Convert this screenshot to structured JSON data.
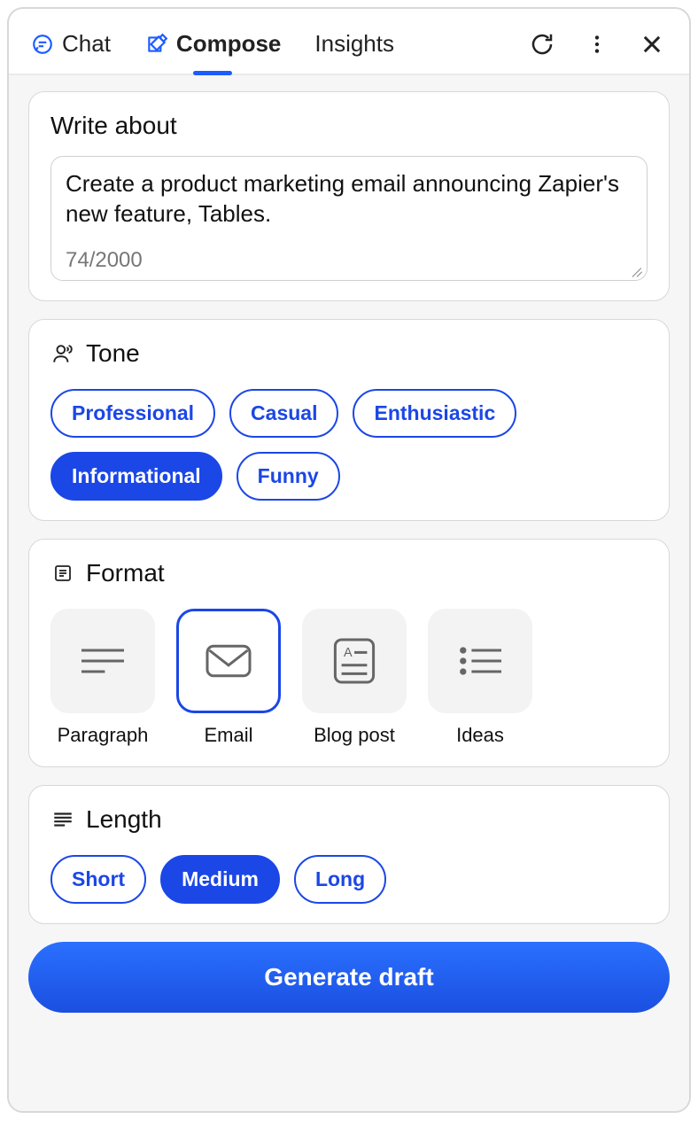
{
  "header": {
    "tabs": [
      {
        "id": "chat",
        "label": "Chat",
        "active": false
      },
      {
        "id": "compose",
        "label": "Compose",
        "active": true
      },
      {
        "id": "insights",
        "label": "Insights",
        "active": false
      }
    ]
  },
  "write_about": {
    "title": "Write about",
    "value": "Create a product marketing email announcing Zapier's new feature, Tables.",
    "char_count": "74/2000"
  },
  "tone": {
    "title": "Tone",
    "options": [
      "Professional",
      "Casual",
      "Enthusiastic",
      "Informational",
      "Funny"
    ],
    "selected": "Informational"
  },
  "format": {
    "title": "Format",
    "options": [
      "Paragraph",
      "Email",
      "Blog post",
      "Ideas"
    ],
    "selected": "Email"
  },
  "length": {
    "title": "Length",
    "options": [
      "Short",
      "Medium",
      "Long"
    ],
    "selected": "Medium"
  },
  "generate_button": "Generate draft",
  "colors": {
    "accent": "#1b47e6"
  }
}
